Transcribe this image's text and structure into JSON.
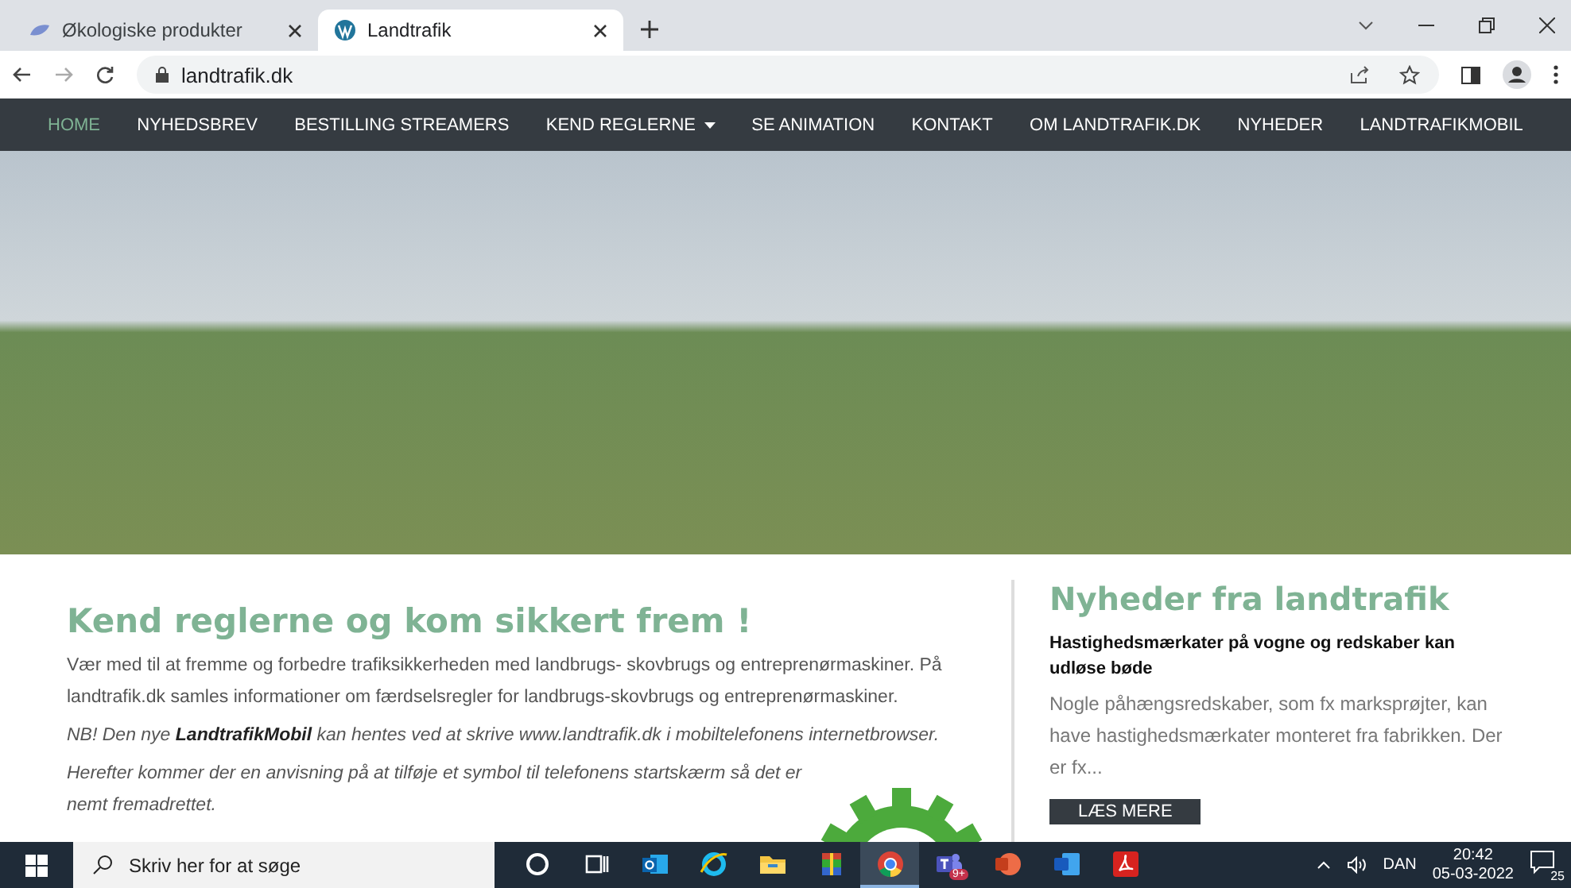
{
  "browser": {
    "tabs": [
      {
        "title": "Økologiske produkter",
        "selected": false,
        "kind": "leaf"
      },
      {
        "title": "Landtrafik",
        "selected": true,
        "kind": "wp"
      }
    ],
    "url": "landtrafik.dk"
  },
  "nav": [
    {
      "label": "HOME",
      "selected": true,
      "dropdown": false
    },
    {
      "label": "NYHEDSBREV",
      "selected": false,
      "dropdown": false
    },
    {
      "label": "BESTILLING STREAMERS",
      "selected": false,
      "dropdown": false
    },
    {
      "label": "KEND REGLERNE",
      "selected": false,
      "dropdown": true
    },
    {
      "label": "SE ANIMATION",
      "selected": false,
      "dropdown": false
    },
    {
      "label": "KONTAKT",
      "selected": false,
      "dropdown": false
    },
    {
      "label": "OM LANDTRAFIK.DK",
      "selected": false,
      "dropdown": false
    },
    {
      "label": "NYHEDER",
      "selected": false,
      "dropdown": false
    },
    {
      "label": "LANDTRAFIKMOBIL",
      "selected": false,
      "dropdown": false
    }
  ],
  "main": {
    "heading": "Kend reglerne og kom sikkert frem !",
    "paragraphs": [
      {
        "kind": "plain",
        "text": "Vær med til at fremme og forbedre trafiksikkerheden med landbrugs- skovbrugs og entreprenørmaskiner. På landtrafik.dk samles informationer om færdselsregler for landbrugs-skovbrugs og entreprenørmaskiner."
      },
      {
        "kind": "italic",
        "text": "NB! Den nye **LandtrafikMobil**  kan hentes ved at skrive www.landtrafik.dk i mobiltelefonens internetbrowser."
      },
      {
        "kind": "italic",
        "text": "Herefter kommer der en anvisning på at tilføje et symbol til telefonens startskærm så det er nemt fremadrettet."
      }
    ]
  },
  "news": {
    "heading": "Nyheder fra landtrafik",
    "title": "Hastighedsmærkater på vogne og redskaber kan udløse bøde",
    "excerpt": "Nogle påhængsredskaber, som fx marksprøjter, kan have hastighedsmærkater monteret fra fabrikken. Der er fx...",
    "button": "LÆS MERE"
  },
  "taskbar": {
    "search_placeholder": "Skriv her for at søge",
    "apps": [
      {
        "kind": "cortana",
        "selected": false
      },
      {
        "kind": "taskview",
        "selected": false
      },
      {
        "kind": "outlook",
        "selected": false
      },
      {
        "kind": "ie",
        "selected": false
      },
      {
        "kind": "explorer",
        "selected": false
      },
      {
        "kind": "winrar",
        "selected": false
      },
      {
        "kind": "chrome",
        "selected": true
      },
      {
        "kind": "teams",
        "selected": false,
        "badge": "9+"
      },
      {
        "kind": "powerpoint",
        "selected": false
      },
      {
        "kind": "word",
        "selected": false
      },
      {
        "kind": "acrobat",
        "selected": false
      }
    ],
    "language": "DAN",
    "time": "20:42",
    "date": "05-03-2022",
    "notifications": "25"
  }
}
